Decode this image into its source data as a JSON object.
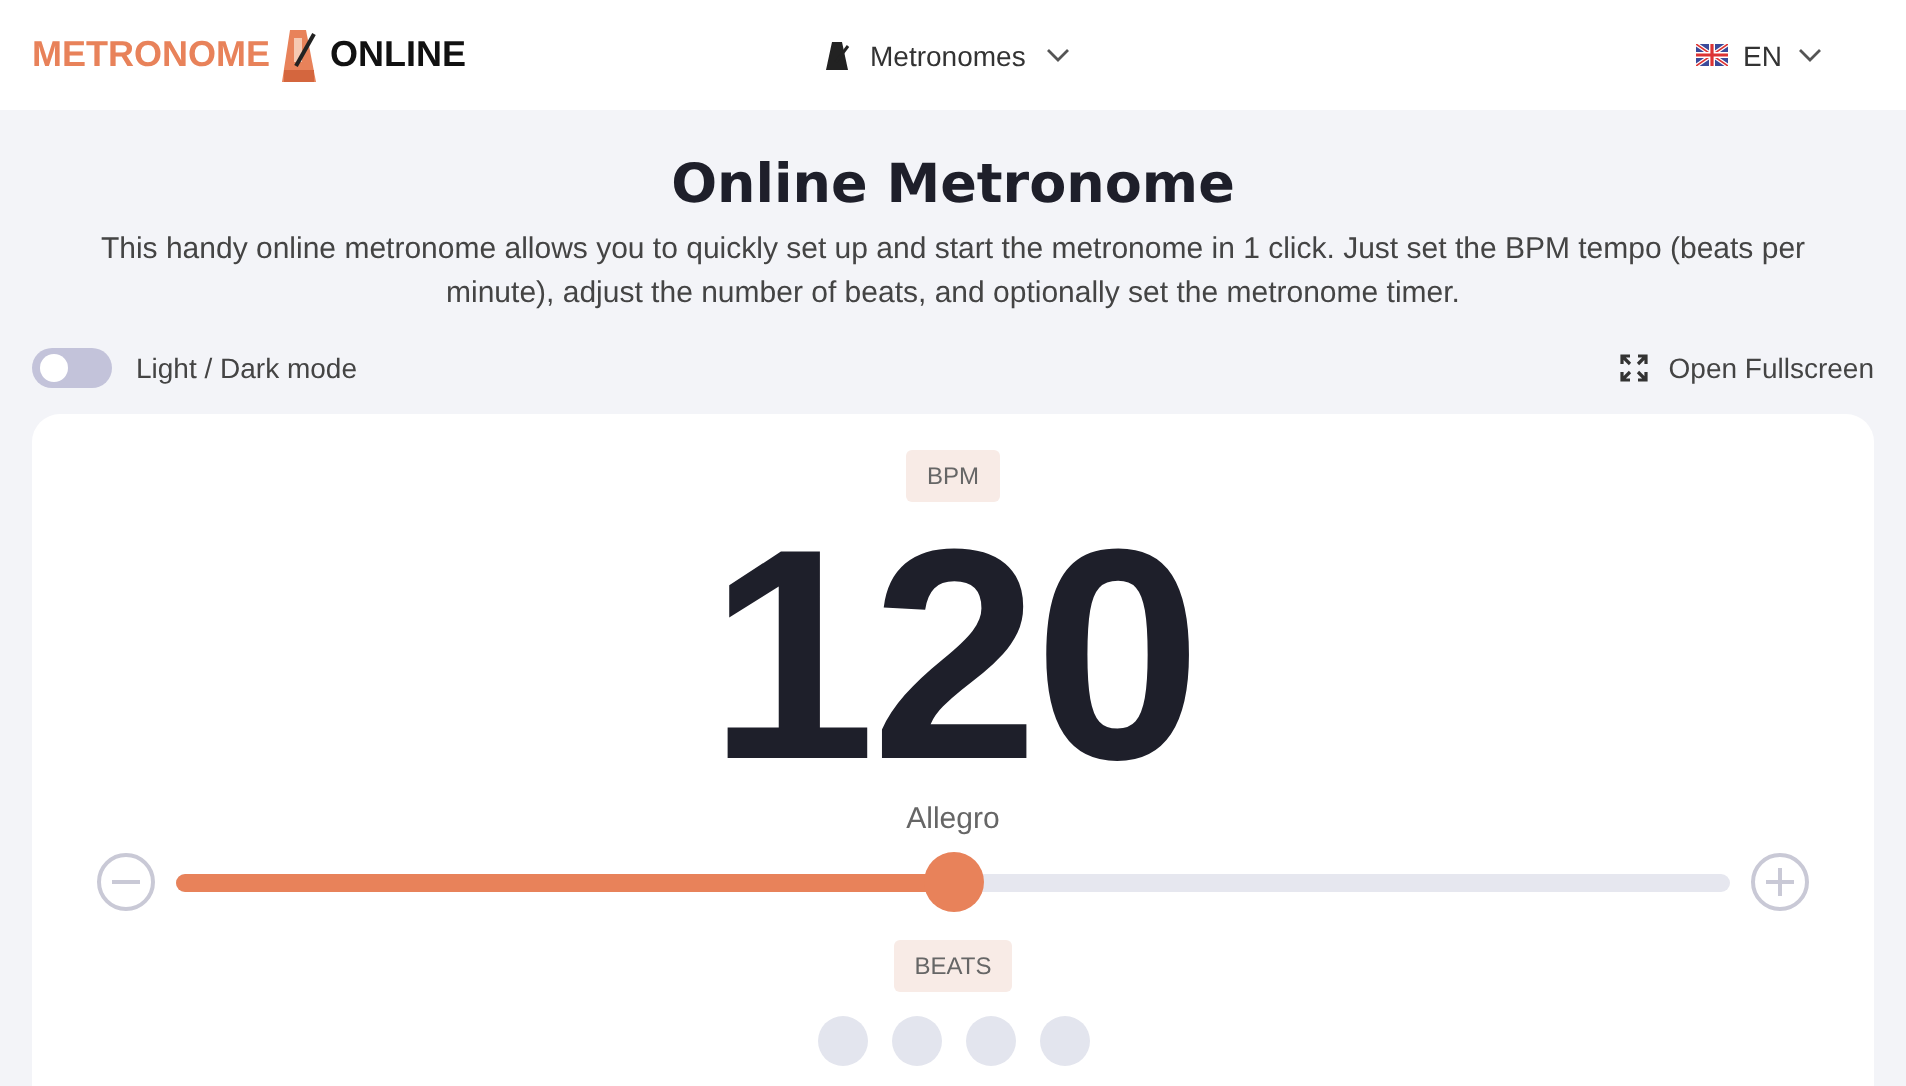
{
  "header": {
    "logo": {
      "left": "METRONOME",
      "right": "ONLINE"
    },
    "nav": {
      "label": "Metronomes"
    },
    "language": {
      "label": "EN"
    }
  },
  "title": "Online Metronome",
  "intro": "This handy online metronome allows you to quickly set up and start the metronome in 1 click. Just set the BPM tempo (beats per minute), adjust the number of beats, and optionally set the metronome timer.",
  "theme_toggle": {
    "label": "Light / Dark mode",
    "on": false
  },
  "fullscreen": {
    "label": "Open Fullscreen"
  },
  "metronome": {
    "bpm_label": "BPM",
    "bpm": "120",
    "tempo_name": "Allegro",
    "slider": {
      "level": 0.5
    },
    "beats_label": "BEATS",
    "beats": [
      {
        "kind": "dot"
      },
      {
        "kind": "dot"
      },
      {
        "kind": "dot"
      },
      {
        "kind": "dot"
      }
    ]
  }
}
